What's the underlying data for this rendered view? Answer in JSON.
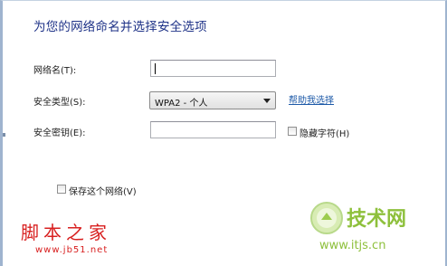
{
  "dialog": {
    "title": "为您的网络命名并选择安全选项"
  },
  "form": {
    "network_name_label": "网络名(T):",
    "network_name_value": "",
    "security_type_label": "安全类型(S):",
    "security_type_value": "WPA2 - 个人",
    "help_link": "帮助我选择",
    "security_key_label": "安全密钥(E):",
    "security_key_value": "",
    "hide_chars_label": "隐藏字符(H)",
    "hide_chars_checked": false,
    "save_network_label": "保存这个网络(V)",
    "save_network_checked": false
  },
  "watermarks": {
    "left_text": "脚本之家",
    "left_url": "www.jb51.net",
    "right_text": "技术网",
    "right_url": "www.itjs.cn"
  },
  "colors": {
    "title": "#1e3287",
    "link": "#1e5aa8",
    "watermark_red": "#d82020",
    "watermark_green": "#8ec03c"
  }
}
